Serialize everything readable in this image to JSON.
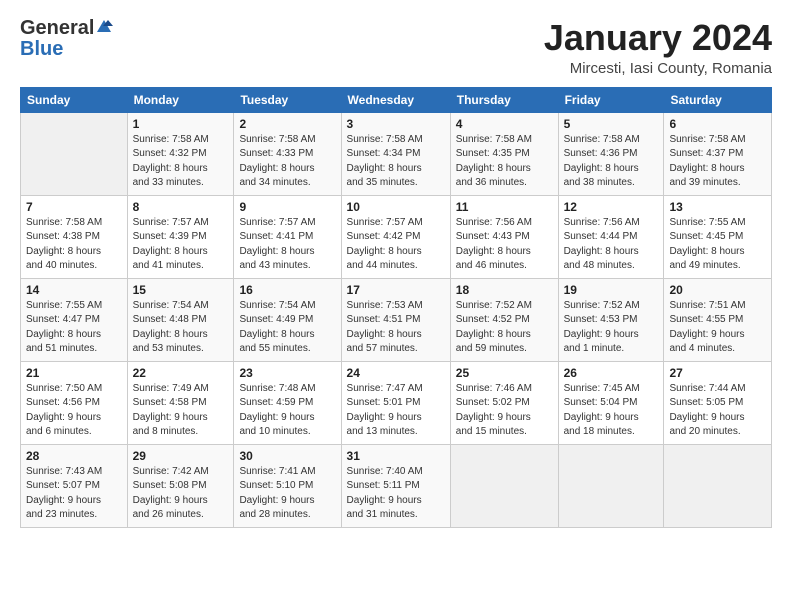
{
  "header": {
    "logo_general": "General",
    "logo_blue": "Blue",
    "title": "January 2024",
    "subtitle": "Mircesti, Iasi County, Romania"
  },
  "weekdays": [
    "Sunday",
    "Monday",
    "Tuesday",
    "Wednesday",
    "Thursday",
    "Friday",
    "Saturday"
  ],
  "weeks": [
    [
      {
        "num": "",
        "info": ""
      },
      {
        "num": "1",
        "info": "Sunrise: 7:58 AM\nSunset: 4:32 PM\nDaylight: 8 hours\nand 33 minutes."
      },
      {
        "num": "2",
        "info": "Sunrise: 7:58 AM\nSunset: 4:33 PM\nDaylight: 8 hours\nand 34 minutes."
      },
      {
        "num": "3",
        "info": "Sunrise: 7:58 AM\nSunset: 4:34 PM\nDaylight: 8 hours\nand 35 minutes."
      },
      {
        "num": "4",
        "info": "Sunrise: 7:58 AM\nSunset: 4:35 PM\nDaylight: 8 hours\nand 36 minutes."
      },
      {
        "num": "5",
        "info": "Sunrise: 7:58 AM\nSunset: 4:36 PM\nDaylight: 8 hours\nand 38 minutes."
      },
      {
        "num": "6",
        "info": "Sunrise: 7:58 AM\nSunset: 4:37 PM\nDaylight: 8 hours\nand 39 minutes."
      }
    ],
    [
      {
        "num": "7",
        "info": "Sunrise: 7:58 AM\nSunset: 4:38 PM\nDaylight: 8 hours\nand 40 minutes."
      },
      {
        "num": "8",
        "info": "Sunrise: 7:57 AM\nSunset: 4:39 PM\nDaylight: 8 hours\nand 41 minutes."
      },
      {
        "num": "9",
        "info": "Sunrise: 7:57 AM\nSunset: 4:41 PM\nDaylight: 8 hours\nand 43 minutes."
      },
      {
        "num": "10",
        "info": "Sunrise: 7:57 AM\nSunset: 4:42 PM\nDaylight: 8 hours\nand 44 minutes."
      },
      {
        "num": "11",
        "info": "Sunrise: 7:56 AM\nSunset: 4:43 PM\nDaylight: 8 hours\nand 46 minutes."
      },
      {
        "num": "12",
        "info": "Sunrise: 7:56 AM\nSunset: 4:44 PM\nDaylight: 8 hours\nand 48 minutes."
      },
      {
        "num": "13",
        "info": "Sunrise: 7:55 AM\nSunset: 4:45 PM\nDaylight: 8 hours\nand 49 minutes."
      }
    ],
    [
      {
        "num": "14",
        "info": "Sunrise: 7:55 AM\nSunset: 4:47 PM\nDaylight: 8 hours\nand 51 minutes."
      },
      {
        "num": "15",
        "info": "Sunrise: 7:54 AM\nSunset: 4:48 PM\nDaylight: 8 hours\nand 53 minutes."
      },
      {
        "num": "16",
        "info": "Sunrise: 7:54 AM\nSunset: 4:49 PM\nDaylight: 8 hours\nand 55 minutes."
      },
      {
        "num": "17",
        "info": "Sunrise: 7:53 AM\nSunset: 4:51 PM\nDaylight: 8 hours\nand 57 minutes."
      },
      {
        "num": "18",
        "info": "Sunrise: 7:52 AM\nSunset: 4:52 PM\nDaylight: 8 hours\nand 59 minutes."
      },
      {
        "num": "19",
        "info": "Sunrise: 7:52 AM\nSunset: 4:53 PM\nDaylight: 9 hours\nand 1 minute."
      },
      {
        "num": "20",
        "info": "Sunrise: 7:51 AM\nSunset: 4:55 PM\nDaylight: 9 hours\nand 4 minutes."
      }
    ],
    [
      {
        "num": "21",
        "info": "Sunrise: 7:50 AM\nSunset: 4:56 PM\nDaylight: 9 hours\nand 6 minutes."
      },
      {
        "num": "22",
        "info": "Sunrise: 7:49 AM\nSunset: 4:58 PM\nDaylight: 9 hours\nand 8 minutes."
      },
      {
        "num": "23",
        "info": "Sunrise: 7:48 AM\nSunset: 4:59 PM\nDaylight: 9 hours\nand 10 minutes."
      },
      {
        "num": "24",
        "info": "Sunrise: 7:47 AM\nSunset: 5:01 PM\nDaylight: 9 hours\nand 13 minutes."
      },
      {
        "num": "25",
        "info": "Sunrise: 7:46 AM\nSunset: 5:02 PM\nDaylight: 9 hours\nand 15 minutes."
      },
      {
        "num": "26",
        "info": "Sunrise: 7:45 AM\nSunset: 5:04 PM\nDaylight: 9 hours\nand 18 minutes."
      },
      {
        "num": "27",
        "info": "Sunrise: 7:44 AM\nSunset: 5:05 PM\nDaylight: 9 hours\nand 20 minutes."
      }
    ],
    [
      {
        "num": "28",
        "info": "Sunrise: 7:43 AM\nSunset: 5:07 PM\nDaylight: 9 hours\nand 23 minutes."
      },
      {
        "num": "29",
        "info": "Sunrise: 7:42 AM\nSunset: 5:08 PM\nDaylight: 9 hours\nand 26 minutes."
      },
      {
        "num": "30",
        "info": "Sunrise: 7:41 AM\nSunset: 5:10 PM\nDaylight: 9 hours\nand 28 minutes."
      },
      {
        "num": "31",
        "info": "Sunrise: 7:40 AM\nSunset: 5:11 PM\nDaylight: 9 hours\nand 31 minutes."
      },
      {
        "num": "",
        "info": ""
      },
      {
        "num": "",
        "info": ""
      },
      {
        "num": "",
        "info": ""
      }
    ]
  ]
}
